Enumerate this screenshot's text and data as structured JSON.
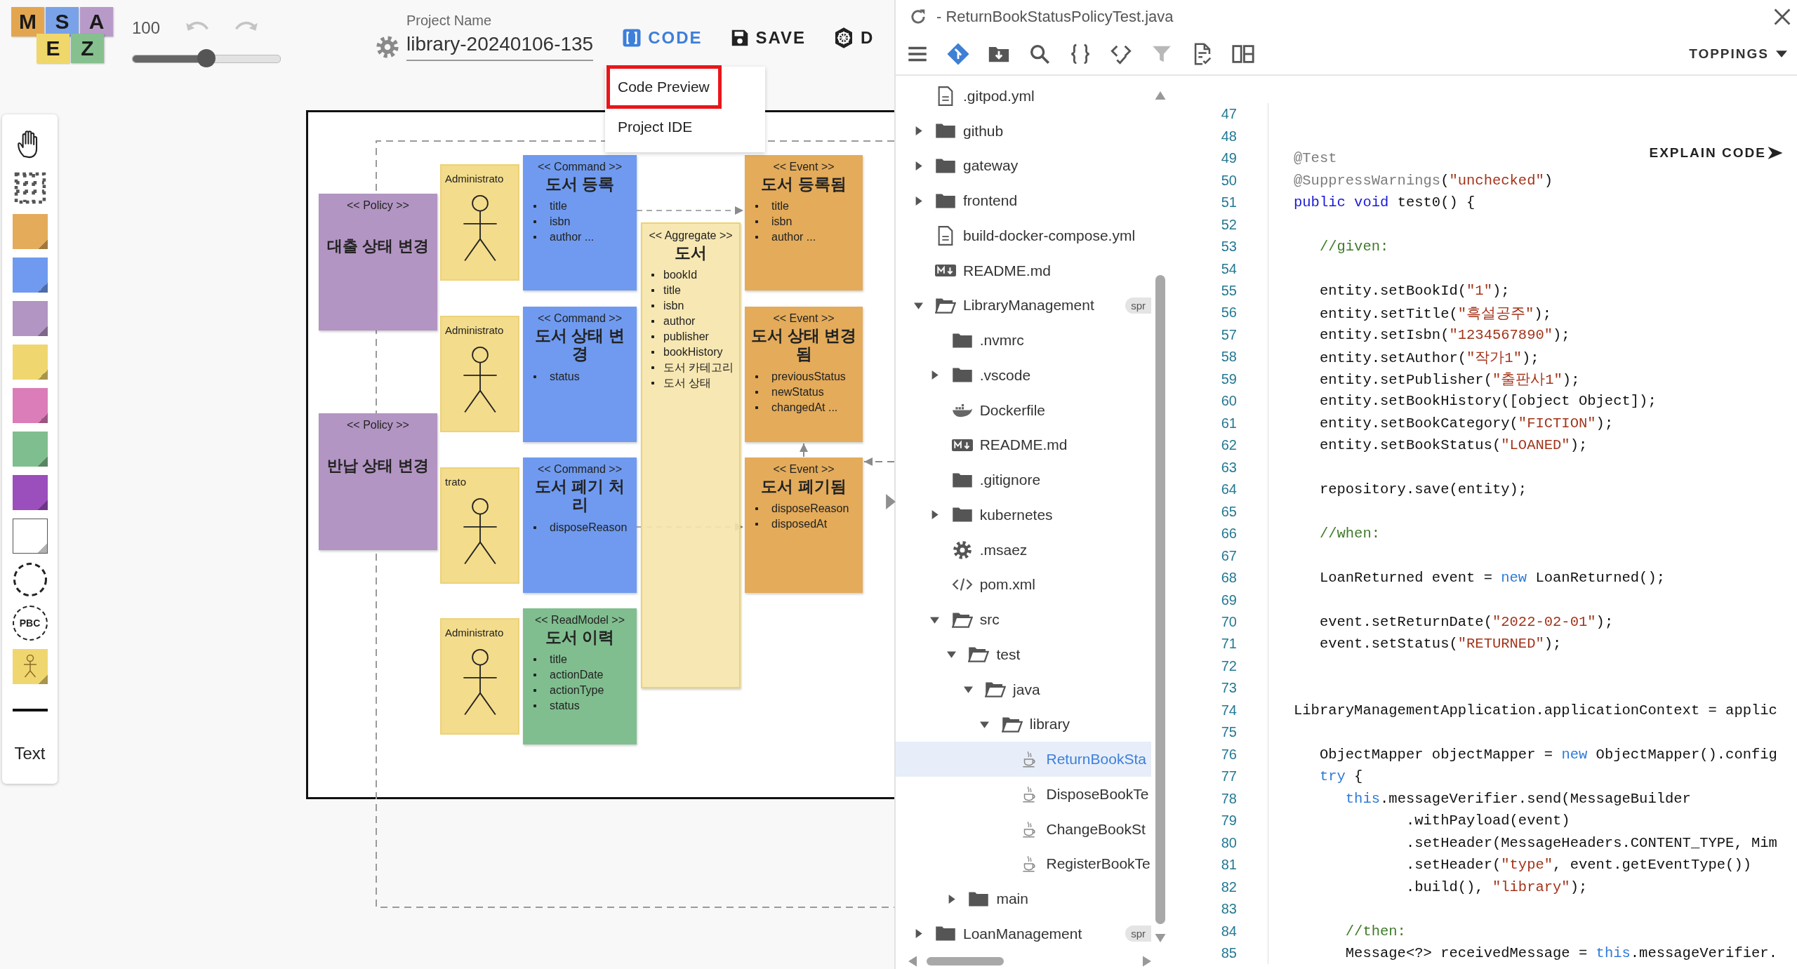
{
  "logo": {
    "letters": [
      {
        "char": "M",
        "color": "#e3a64f"
      },
      {
        "char": "S",
        "color": "#7aa2e8"
      },
      {
        "char": "A",
        "color": "#b89ac8"
      },
      {
        "char": "E",
        "color": "#f0d76c"
      },
      {
        "char": "Z",
        "color": "#86c08f"
      }
    ]
  },
  "toolbar": {
    "zoom": {
      "value": "100",
      "level": 0.5
    },
    "project": {
      "label": "Project Name",
      "value": "library-20240106-135"
    },
    "buttons": [
      {
        "kind": "code",
        "label": "CODE",
        "selected": true
      },
      {
        "kind": "save",
        "label": "SAVE",
        "selected": false
      },
      {
        "kind": "deploy",
        "label": "D",
        "selected": false
      }
    ]
  },
  "code_menu": {
    "items": [
      {
        "label": "Code Preview",
        "selected": true
      },
      {
        "label": "Project IDE",
        "selected": false
      }
    ]
  },
  "palette": [
    {
      "kind": "hand"
    },
    {
      "kind": "select"
    },
    {
      "kind": "sticky",
      "color": "#e3ab5a"
    },
    {
      "kind": "sticky",
      "color": "#6f9aef"
    },
    {
      "kind": "sticky",
      "color": "#b295c2"
    },
    {
      "kind": "sticky",
      "color": "#f0d66f"
    },
    {
      "kind": "sticky",
      "color": "#db7db8"
    },
    {
      "kind": "sticky",
      "color": "#7fbe8e"
    },
    {
      "kind": "sticky",
      "color": "#9a4fbd"
    },
    {
      "kind": "sticky",
      "color": "#ffffff"
    },
    {
      "kind": "boundary"
    },
    {
      "kind": "pbc",
      "label": "PBC"
    },
    {
      "kind": "actor",
      "color": "#f0d66f"
    },
    {
      "kind": "line"
    },
    {
      "kind": "text",
      "label": "Text"
    }
  ],
  "canvas": {
    "actors": [
      {
        "label": "Administrato"
      },
      {
        "label": "Administrato"
      },
      {
        "label": "trato"
      },
      {
        "label": "Administrato"
      }
    ],
    "policies": [
      {
        "stereotype": "<< Policy >>",
        "name": "대출 상태 변경"
      },
      {
        "stereotype": "<< Policy >>",
        "name": "반납 상태 변경"
      }
    ],
    "commands": [
      {
        "stereotype": "<< Command >>",
        "name": "도서 등록",
        "fields": [
          "title",
          "isbn",
          "author ..."
        ]
      },
      {
        "stereotype": "<< Command >>",
        "name": "도서 상태 변경",
        "fields": [
          "status"
        ]
      },
      {
        "stereotype": "<< Command >>",
        "name": "도서 폐기 처리",
        "fields": [
          "disposeReason"
        ]
      }
    ],
    "read_model": {
      "stereotype": "<< ReadModel >>",
      "name": "도서 이력",
      "fields": [
        "title",
        "actionDate",
        "actionType",
        "status"
      ]
    },
    "aggregate": {
      "stereotype": "<< Aggregate >>",
      "name": "도서",
      "fields": [
        "bookId",
        "title",
        "isbn",
        "author",
        "publisher",
        "bookHistory",
        "도서 카테고리",
        "도서 상태"
      ]
    },
    "events": [
      {
        "stereotype": "<< Event >>",
        "name": "도서 등록됨",
        "fields": [
          "title",
          "isbn",
          "author ..."
        ]
      },
      {
        "stereotype": "<< Event >>",
        "name": "도서 상태 변경됨",
        "fields": [
          "previousStatus",
          "newStatus",
          "changedAt ..."
        ]
      },
      {
        "stereotype": "<< Event >>",
        "name": "도서 폐기됨",
        "fields": [
          "disposeReason",
          "disposedAt"
        ]
      }
    ]
  },
  "editor": {
    "title": "- ReturnBookStatusPolicyTest.java",
    "toppings": "TOPPINGS",
    "explain": "EXPLAIN CODE"
  },
  "file_tree": [
    {
      "name": ".gitpod.yml",
      "kind": "file",
      "selected": false
    },
    {
      "name": "github",
      "kind": "folder",
      "expanded": false,
      "selected": false
    },
    {
      "name": "gateway",
      "kind": "folder",
      "expanded": false,
      "selected": false
    },
    {
      "name": "frontend",
      "kind": "folder",
      "expanded": false,
      "selected": false
    },
    {
      "name": "build-docker-compose.yml",
      "kind": "file",
      "selected": false
    },
    {
      "name": "README.md",
      "kind": "markdown",
      "selected": false
    },
    {
      "name": "LibraryManagement",
      "kind": "folder",
      "expanded": true,
      "selected": false,
      "badge": "spr",
      "children": [
        {
          "name": ".nvmrc",
          "kind": "folder",
          "selected": false
        },
        {
          "name": ".vscode",
          "kind": "folder",
          "expanded": false,
          "selected": false
        },
        {
          "name": "Dockerfile",
          "kind": "docker",
          "selected": false
        },
        {
          "name": "README.md",
          "kind": "markdown",
          "selected": false
        },
        {
          "name": ".gitignore",
          "kind": "folder",
          "selected": false
        },
        {
          "name": "kubernetes",
          "kind": "folder",
          "expanded": false,
          "selected": false
        },
        {
          "name": ".msaez",
          "kind": "gear",
          "selected": false
        },
        {
          "name": "pom.xml",
          "kind": "code",
          "selected": false
        },
        {
          "name": "src",
          "kind": "folder",
          "expanded": true,
          "selected": false,
          "children": [
            {
              "name": "test",
              "kind": "folder",
              "expanded": true,
              "selected": false,
              "children": [
                {
                  "name": "java",
                  "kind": "folder",
                  "expanded": true,
                  "selected": false,
                  "children": [
                    {
                      "name": "library",
                      "kind": "folder",
                      "expanded": true,
                      "selected": false,
                      "children": [
                        {
                          "name": "ReturnBookSta",
                          "kind": "java",
                          "selected": true
                        },
                        {
                          "name": "DisposeBookTe",
                          "kind": "java",
                          "selected": false
                        },
                        {
                          "name": "ChangeBookSt",
                          "kind": "java",
                          "selected": false
                        },
                        {
                          "name": "RegisterBookTe",
                          "kind": "java",
                          "selected": false
                        }
                      ]
                    }
                  ]
                }
              ]
            },
            {
              "name": "main",
              "kind": "folder",
              "expanded": false,
              "selected": false
            }
          ]
        }
      ]
    },
    {
      "name": "LoanManagement",
      "kind": "folder",
      "expanded": false,
      "selected": false,
      "badge": "spr"
    }
  ],
  "code": {
    "lines": [
      {
        "number": "47"
      },
      {
        "number": "48"
      },
      {
        "number": "49",
        "tokens": [
          {
            "kind": "annotation",
            "text": "@Test"
          }
        ]
      },
      {
        "number": "50",
        "tokens": [
          {
            "kind": "annotation",
            "text": "@SuppressWarnings"
          },
          {
            "kind": "plain",
            "text": "("
          },
          {
            "kind": "string",
            "text": "\"unchecked\""
          },
          {
            "kind": "plain",
            "text": ")"
          }
        ]
      },
      {
        "number": "51",
        "tokens": [
          {
            "kind": "keyword",
            "text": "public void"
          },
          {
            "kind": "plain",
            "text": " test0() {"
          }
        ]
      },
      {
        "number": "52"
      },
      {
        "number": "53",
        "tokens": [
          {
            "kind": "comment",
            "text": "   //given:"
          }
        ]
      },
      {
        "number": "54"
      },
      {
        "number": "55",
        "tokens": [
          {
            "kind": "plain",
            "text": "   entity.setBookId("
          },
          {
            "kind": "string",
            "text": "\"1\""
          },
          {
            "kind": "plain",
            "text": ");"
          }
        ]
      },
      {
        "number": "56",
        "tokens": [
          {
            "kind": "plain",
            "text": "   entity.setTitle("
          },
          {
            "kind": "string",
            "text": "\"흑설공주\""
          },
          {
            "kind": "plain",
            "text": ");"
          }
        ]
      },
      {
        "number": "57",
        "tokens": [
          {
            "kind": "plain",
            "text": "   entity.setIsbn("
          },
          {
            "kind": "string",
            "text": "\"1234567890\""
          },
          {
            "kind": "plain",
            "text": ");"
          }
        ]
      },
      {
        "number": "58",
        "tokens": [
          {
            "kind": "plain",
            "text": "   entity.setAuthor("
          },
          {
            "kind": "string",
            "text": "\"작가1\""
          },
          {
            "kind": "plain",
            "text": ");"
          }
        ]
      },
      {
        "number": "59",
        "tokens": [
          {
            "kind": "plain",
            "text": "   entity.setPublisher("
          },
          {
            "kind": "string",
            "text": "\"출판사1\""
          },
          {
            "kind": "plain",
            "text": ");"
          }
        ]
      },
      {
        "number": "60",
        "tokens": [
          {
            "kind": "plain",
            "text": "   entity.setBookHistory([object Object]);"
          }
        ]
      },
      {
        "number": "61",
        "tokens": [
          {
            "kind": "plain",
            "text": "   entity.setBookCategory("
          },
          {
            "kind": "string",
            "text": "\"FICTION\""
          },
          {
            "kind": "plain",
            "text": ");"
          }
        ]
      },
      {
        "number": "62",
        "tokens": [
          {
            "kind": "plain",
            "text": "   entity.setBookStatus("
          },
          {
            "kind": "string",
            "text": "\"LOANED\""
          },
          {
            "kind": "plain",
            "text": ");"
          }
        ]
      },
      {
        "number": "63"
      },
      {
        "number": "64",
        "tokens": [
          {
            "kind": "plain",
            "text": "   repository.save(entity);"
          }
        ]
      },
      {
        "number": "65"
      },
      {
        "number": "66",
        "tokens": [
          {
            "kind": "comment",
            "text": "   //when:"
          }
        ]
      },
      {
        "number": "67"
      },
      {
        "number": "68",
        "tokens": [
          {
            "kind": "plain",
            "text": "   LoanReturned event = "
          },
          {
            "kind": "soft",
            "text": "new"
          },
          {
            "kind": "plain",
            "text": " LoanReturned();"
          }
        ]
      },
      {
        "number": "69"
      },
      {
        "number": "70",
        "tokens": [
          {
            "kind": "plain",
            "text": "   event.setReturnDate("
          },
          {
            "kind": "string",
            "text": "\"2022-02-01\""
          },
          {
            "kind": "plain",
            "text": ");"
          }
        ]
      },
      {
        "number": "71",
        "tokens": [
          {
            "kind": "plain",
            "text": "   event.setStatus("
          },
          {
            "kind": "string",
            "text": "\"RETURNED\""
          },
          {
            "kind": "plain",
            "text": ");"
          }
        ]
      },
      {
        "number": "72"
      },
      {
        "number": "73"
      },
      {
        "number": "74",
        "tokens": [
          {
            "kind": "plain",
            "text": "LibraryManagementApplication.applicationContext = applic"
          }
        ]
      },
      {
        "number": "75"
      },
      {
        "number": "76",
        "tokens": [
          {
            "kind": "plain",
            "text": "   ObjectMapper objectMapper = "
          },
          {
            "kind": "soft",
            "text": "new"
          },
          {
            "kind": "plain",
            "text": " ObjectMapper().config"
          }
        ]
      },
      {
        "number": "77",
        "tokens": [
          {
            "kind": "soft",
            "text": "   try"
          },
          {
            "kind": "plain",
            "text": " {"
          }
        ]
      },
      {
        "number": "78",
        "tokens": [
          {
            "kind": "soft",
            "text": "      this"
          },
          {
            "kind": "plain",
            "text": ".messageVerifier.send(MessageBuilder"
          }
        ]
      },
      {
        "number": "79",
        "tokens": [
          {
            "kind": "plain",
            "text": "             .withPayload(event)"
          }
        ]
      },
      {
        "number": "80",
        "tokens": [
          {
            "kind": "plain",
            "text": "             .setHeader(MessageHeaders.CONTENT_TYPE, Mim"
          }
        ]
      },
      {
        "number": "81",
        "tokens": [
          {
            "kind": "plain",
            "text": "             .setHeader("
          },
          {
            "kind": "string",
            "text": "\"type\""
          },
          {
            "kind": "plain",
            "text": ", event.getEventType())"
          }
        ]
      },
      {
        "number": "82",
        "tokens": [
          {
            "kind": "plain",
            "text": "             .build(), "
          },
          {
            "kind": "string",
            "text": "\"library\""
          },
          {
            "kind": "plain",
            "text": ");"
          }
        ]
      },
      {
        "number": "83"
      },
      {
        "number": "84",
        "tokens": [
          {
            "kind": "comment",
            "text": "      //then:"
          }
        ]
      },
      {
        "number": "85",
        "tokens": [
          {
            "kind": "plain",
            "text": "      Message<?> receivedMessage = "
          },
          {
            "kind": "soft",
            "text": "this"
          },
          {
            "kind": "plain",
            "text": ".messageVerifier."
          }
        ]
      }
    ]
  }
}
